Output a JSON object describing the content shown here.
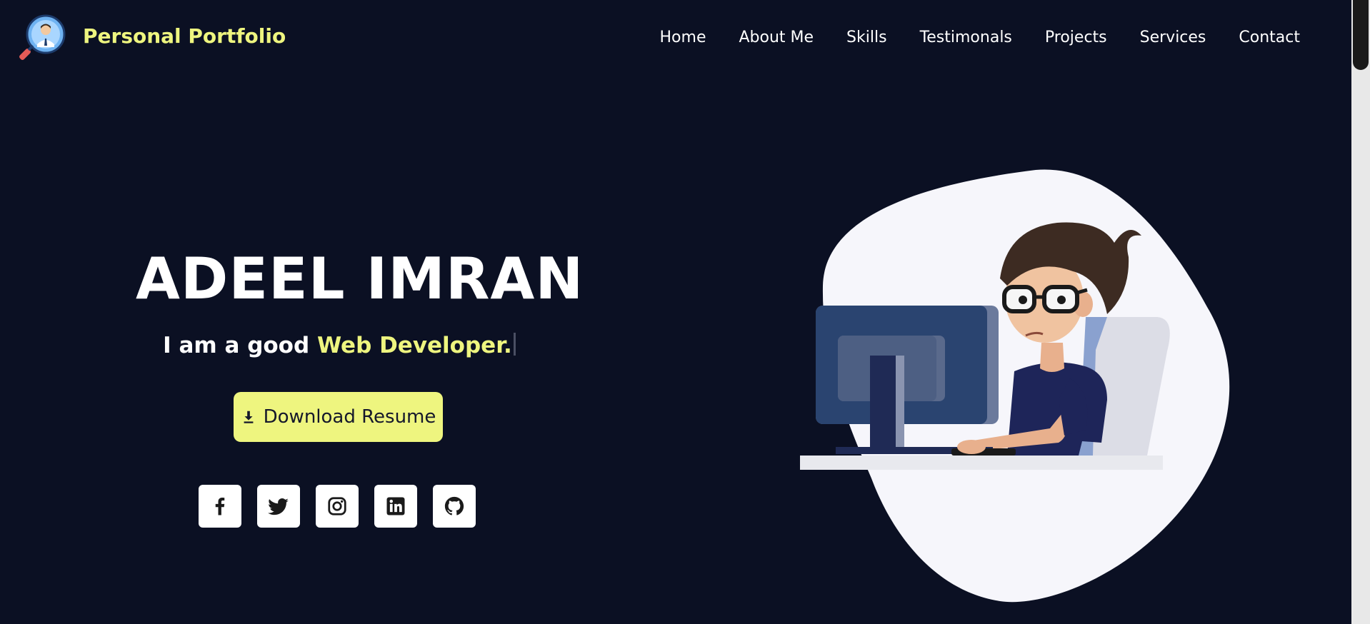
{
  "header": {
    "brand": "Personal Portfolio",
    "logo_icon": "developer-search-icon",
    "nav": [
      {
        "label": "Home"
      },
      {
        "label": "About Me"
      },
      {
        "label": "Skills"
      },
      {
        "label": "Testimonals"
      },
      {
        "label": "Projects"
      },
      {
        "label": "Services"
      },
      {
        "label": "Contact"
      }
    ]
  },
  "hero": {
    "name": "ADEEL IMRAN",
    "tagline_prefix": "I am a good ",
    "tagline_role": "Web Developer.",
    "download_label": "Download Resume",
    "socials": [
      {
        "icon": "facebook-icon"
      },
      {
        "icon": "twitter-icon"
      },
      {
        "icon": "instagram-icon"
      },
      {
        "icon": "linkedin-icon"
      },
      {
        "icon": "github-icon"
      }
    ],
    "illustration": "developer-at-computer-illustration"
  },
  "colors": {
    "background": "#0b1023",
    "accent": "#eef57f",
    "text": "#ffffff"
  }
}
